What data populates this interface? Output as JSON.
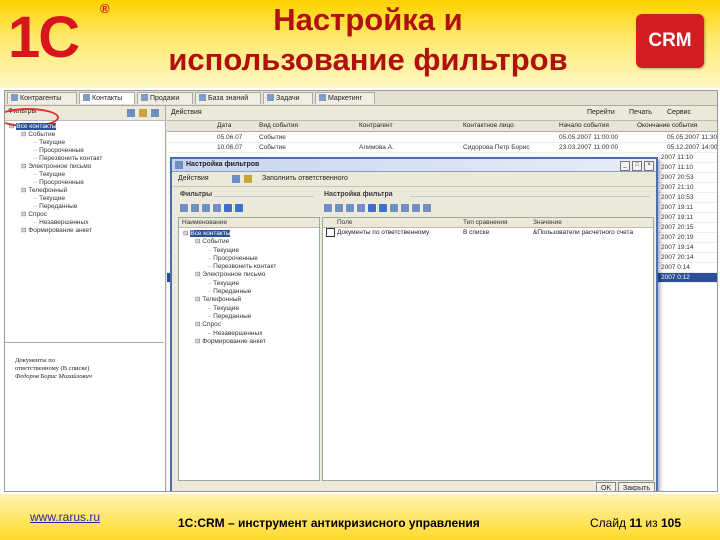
{
  "slide": {
    "title_line1": "Настройка и",
    "title_line2": "использование фильтров",
    "logo_text": "1С",
    "logo_reg": "®",
    "crm_badge": "CRM",
    "footer_url": "www.rarus.ru",
    "footer_caption": "1С:CRM – инструмент антикризисного управления",
    "page_prefix": "Слайд",
    "page_current": "11",
    "page_sep": "из",
    "page_total": "105"
  },
  "tabs": [
    "Контрагенты",
    "Контакты",
    "Продажи",
    "База знаний",
    "Задачи",
    "Маркетинг"
  ],
  "left": {
    "toolbar_label": "Фильтры",
    "tree": [
      {
        "text": "Все контакты",
        "indent": 0,
        "sel": true
      },
      {
        "text": "Событие",
        "indent": 1
      },
      {
        "text": "Текущие",
        "indent": 2
      },
      {
        "text": "Просроченные",
        "indent": 2
      },
      {
        "text": "Перезвонить контакт",
        "indent": 2
      },
      {
        "text": "Электронное письмо",
        "indent": 1
      },
      {
        "text": "Текущие",
        "indent": 2
      },
      {
        "text": "Просроченные",
        "indent": 2
      },
      {
        "text": "Телефонный",
        "indent": 1
      },
      {
        "text": "Текущие",
        "indent": 2
      },
      {
        "text": "Переданные",
        "indent": 2
      },
      {
        "text": "Спрос",
        "indent": 1
      },
      {
        "text": "Незавершенных",
        "indent": 2
      },
      {
        "text": "Формирование анкет",
        "indent": 1
      }
    ],
    "note_lines": [
      "Документы по",
      "ответственному (В списке)",
      "Федоров Борис Михайлович"
    ]
  },
  "grid": {
    "toolbar": [
      "Действия",
      "Перейти",
      "Печать",
      "Сервис"
    ],
    "columns": [
      "Дата",
      "Вид события",
      "Контрагент",
      "Контактное лицо",
      "Начало события",
      "Окончание события"
    ],
    "rows": [
      [
        "05.06.07",
        "Событие",
        "",
        "",
        "05.05.2007 11:00:00",
        "05.05.2007 11:30"
      ],
      [
        "10.06.07",
        "Событие",
        "Алимова А.",
        "Сидорова Петр Борис",
        "23.03.2007 11:00:00",
        "05.12.2007 14:00"
      ],
      [
        "",
        "",
        "",
        "",
        "",
        "2007 11:10"
      ],
      [
        "",
        "",
        "",
        "",
        "",
        "2007 11:10"
      ],
      [
        "",
        "",
        "",
        "",
        "",
        "2007 20:53"
      ],
      [
        "",
        "",
        "",
        "",
        "",
        "2007 21:10"
      ],
      [
        "",
        "",
        "",
        "",
        "",
        "2007 10:53"
      ],
      [
        "",
        "",
        "",
        "",
        "",
        "2007 19:11"
      ],
      [
        "",
        "",
        "",
        "",
        "",
        "2007 19:11"
      ],
      [
        "",
        "",
        "",
        "",
        "",
        "2007 20:15"
      ],
      [
        "",
        "",
        "",
        "",
        "",
        "2007 20:19"
      ],
      [
        "",
        "",
        "",
        "",
        "",
        "2007 19:14"
      ],
      [
        "",
        "",
        "",
        "",
        "",
        "2007 20:14"
      ],
      [
        "",
        "",
        "",
        "",
        "",
        "2007 0:14"
      ],
      [
        "",
        "",
        "",
        "",
        "",
        "2007 0:12"
      ]
    ]
  },
  "dialog": {
    "title": "Настройка фильтров",
    "toolbar_actions": "Действия",
    "toolbar_fill": "Заполнить ответственного",
    "sec_filters": "Фильтры",
    "sec_filter_settings": "Настройка фильтра",
    "left_header": "Наименование",
    "tree": [
      {
        "text": "Все контакты",
        "indent": 0,
        "sel": true
      },
      {
        "text": "Событие",
        "indent": 1
      },
      {
        "text": "Текущие",
        "indent": 2
      },
      {
        "text": "Просроченные",
        "indent": 2
      },
      {
        "text": "Перезвонить контакт",
        "indent": 2
      },
      {
        "text": "Электронное письмо",
        "indent": 1
      },
      {
        "text": "Текущие",
        "indent": 2
      },
      {
        "text": "Переданные",
        "indent": 2
      },
      {
        "text": "Телефонный",
        "indent": 1
      },
      {
        "text": "Текущие",
        "indent": 2
      },
      {
        "text": "Переданные",
        "indent": 2
      },
      {
        "text": "Спрос",
        "indent": 1
      },
      {
        "text": "Незавершенных",
        "indent": 2
      },
      {
        "text": "Формирование анкет",
        "indent": 1
      }
    ],
    "right_headers": [
      "Поле",
      "Тип сравнения",
      "Значение"
    ],
    "filter_row": {
      "field": "Документы по ответственному",
      "compare": "В списке",
      "value": "&Пользователи расчетного счета"
    },
    "ok": "OK",
    "close": "Закрыть",
    "close_icon": "×"
  },
  "colors": {
    "accent": "#d41c23",
    "title": "#b01010",
    "selection": "#2b4f9a",
    "header_yellow": "#ffd200"
  }
}
